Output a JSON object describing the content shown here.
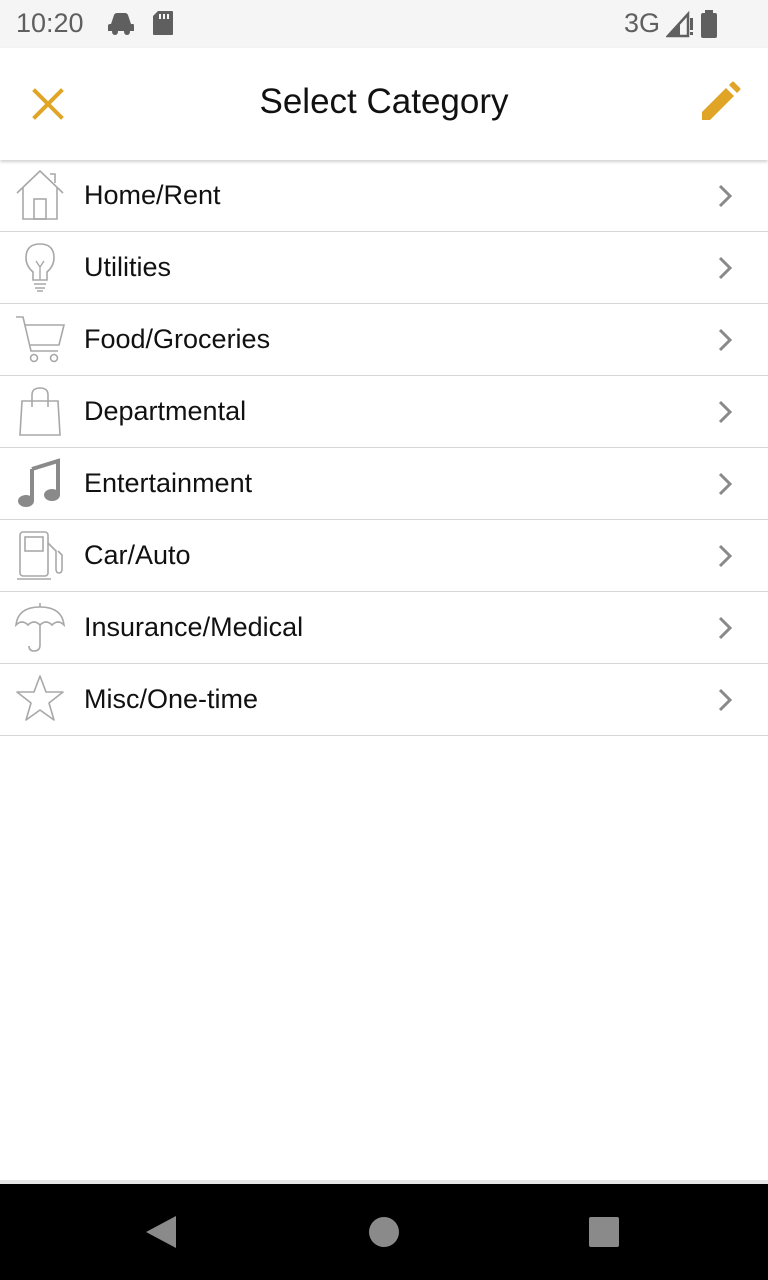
{
  "status_bar": {
    "time": "10:20",
    "network": "3G",
    "left_icons": [
      "car-icon",
      "sd-card-icon"
    ],
    "right_icons": [
      "signal-icon",
      "battery-icon"
    ]
  },
  "header": {
    "title": "Select Category",
    "close_icon": "close-icon",
    "edit_icon": "pencil-icon",
    "accent_color": "#E0A526"
  },
  "categories": [
    {
      "label": "Home/Rent",
      "icon": "home-icon"
    },
    {
      "label": "Utilities",
      "icon": "lightbulb-icon"
    },
    {
      "label": "Food/Groceries",
      "icon": "cart-icon"
    },
    {
      "label": "Departmental",
      "icon": "shopping-bag-icon"
    },
    {
      "label": "Entertainment",
      "icon": "music-note-icon"
    },
    {
      "label": "Car/Auto",
      "icon": "gas-pump-icon"
    },
    {
      "label": "Insurance/Medical",
      "icon": "umbrella-icon"
    },
    {
      "label": "Misc/One-time",
      "icon": "star-icon"
    }
  ],
  "nav_bar": {
    "buttons": [
      "back-icon",
      "home-icon",
      "recents-icon"
    ]
  }
}
